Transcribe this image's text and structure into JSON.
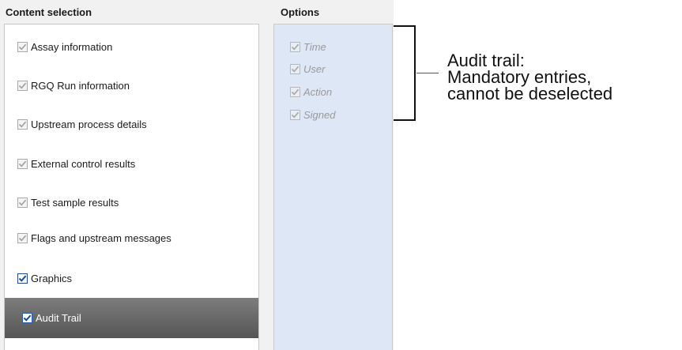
{
  "headers": {
    "content_selection": "Content selection",
    "options": "Options"
  },
  "content_items": [
    {
      "label": "Assay information",
      "checked": true,
      "state": "disabled"
    },
    {
      "label": "RGQ Run information",
      "checked": true,
      "state": "disabled"
    },
    {
      "label": "Upstream process details",
      "checked": true,
      "state": "disabled"
    },
    {
      "label": "External control results",
      "checked": true,
      "state": "disabled"
    },
    {
      "label": "Test sample results",
      "checked": true,
      "state": "disabled"
    },
    {
      "label": "Flags and upstream messages",
      "checked": true,
      "state": "disabled"
    },
    {
      "label": "Graphics",
      "checked": true,
      "state": "enabled"
    },
    {
      "label": "Audit Trail",
      "checked": true,
      "state": "selected"
    }
  ],
  "option_items": [
    {
      "label": "Time",
      "checked": true,
      "state": "disabled"
    },
    {
      "label": "User",
      "checked": true,
      "state": "disabled"
    },
    {
      "label": "Action",
      "checked": true,
      "state": "disabled"
    },
    {
      "label": "Signed",
      "checked": true,
      "state": "disabled"
    }
  ],
  "annotation": {
    "line1": "Audit trail:",
    "line2": "Mandatory entries,",
    "line3": "cannot be deselected"
  },
  "colors": {
    "check_disabled": "#a0a0a0",
    "check_enabled": "#1f4c8a",
    "selected_row": "#6a6a6a",
    "options_background": "#dde7f5"
  }
}
